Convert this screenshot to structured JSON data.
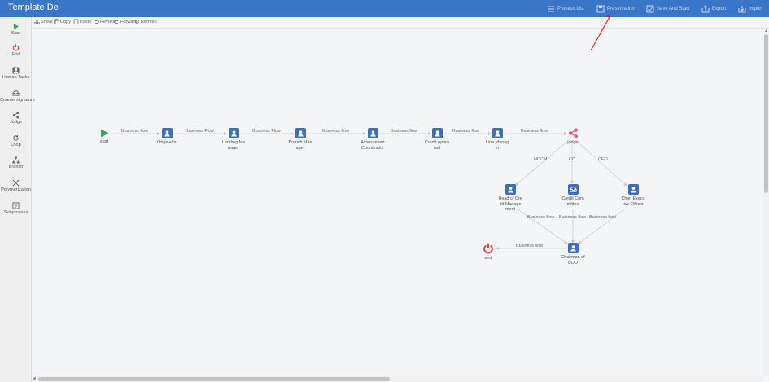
{
  "app": {
    "title": "Template Desig"
  },
  "top_actions": [
    {
      "label": "Process List",
      "icon": "list-icon"
    },
    {
      "label": "Preservation",
      "icon": "save-icon"
    },
    {
      "label": "Save And Start",
      "icon": "check-icon"
    },
    {
      "label": "Export",
      "icon": "export-icon"
    },
    {
      "label": "Import",
      "icon": "import-icon"
    }
  ],
  "tools": [
    {
      "label": "Start",
      "icon": "play-icon"
    },
    {
      "label": "End",
      "icon": "power-icon"
    },
    {
      "label": "Human Tasks",
      "icon": "user-icon"
    },
    {
      "label": "Countersignature",
      "icon": "inbox-icon"
    },
    {
      "label": "Judge",
      "icon": "share-icon"
    },
    {
      "label": "Loop",
      "icon": "loop-icon"
    },
    {
      "label": "Branch",
      "icon": "branch-icon"
    },
    {
      "label": "Polymerization",
      "icon": "merge-icon"
    },
    {
      "label": "Subprocess",
      "icon": "subprocess-icon"
    }
  ],
  "edit_tools": [
    {
      "label": "Shear",
      "icon": "scissors-icon"
    },
    {
      "label": "Copy",
      "icon": "copy-icon"
    },
    {
      "label": "Paste",
      "icon": "paste-icon"
    },
    {
      "label": "Revoke",
      "icon": "undo-icon"
    },
    {
      "label": "Forward",
      "icon": "redo-icon"
    },
    {
      "label": "Refresh",
      "icon": "refresh-icon"
    }
  ],
  "nodes": {
    "start": "start",
    "originator": "Originator",
    "lending_manager": "Lending Manager",
    "branch_manager": "Branch Manager",
    "assessment_coordinator": "Assessment Coordinator",
    "credit_appraisal": "Credit Appraisal",
    "line_manager": "Line Manager",
    "judge": "judge",
    "head_credit": "Head of Credit Management",
    "credit_committee": "Credit Committee",
    "ceo": "Chief Executive Officer",
    "chairman": "Chairman of BOD",
    "end": "end"
  },
  "flows": {
    "f1": "Business flow",
    "f2": "Business Flow",
    "f3": "Business Flow",
    "f4": "Business flow",
    "f5": "Business flow",
    "f6": "Business flow",
    "f7": "Business flow",
    "hocm": "HOCM",
    "cc": "CC",
    "ceo": "CEO",
    "f8": "Business flow",
    "f9": "Business flow",
    "f10": "Business flow",
    "f11": "Business flow"
  },
  "colors": {
    "topbar": "#3a76c8",
    "task": "#3a6fc2",
    "start": "#3aa35a",
    "end": "#e04444",
    "judge": "#e05a7a",
    "annotation": "#e0241b"
  }
}
